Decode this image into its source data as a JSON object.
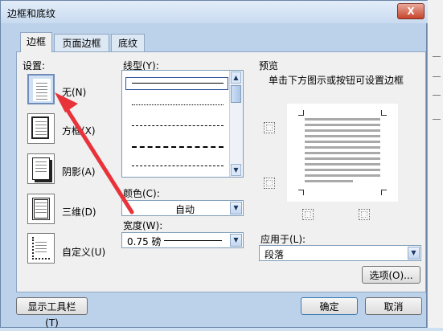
{
  "window": {
    "title": "边框和底纹",
    "close_glyph": "X"
  },
  "tabs": [
    {
      "label": "边框",
      "active": true
    },
    {
      "label": "页面边框",
      "active": false
    },
    {
      "label": "底纹",
      "active": false
    }
  ],
  "settings": {
    "label": "设置:",
    "options": [
      {
        "label": "无(N)",
        "selected": true
      },
      {
        "label": "方框(X)"
      },
      {
        "label": "阴影(A)"
      },
      {
        "label": "三维(D)"
      },
      {
        "label": "自定义(U)"
      }
    ]
  },
  "line_style": {
    "label": "线型(Y):"
  },
  "color": {
    "label": "颜色(C):",
    "value": "自动"
  },
  "width": {
    "label": "宽度(W):",
    "value": "0.75 磅"
  },
  "preview": {
    "label": "预览",
    "hint": "单击下方图示或按钮可设置边框"
  },
  "apply_to": {
    "label": "应用于(L):",
    "value": "段落"
  },
  "buttons": {
    "options": "选项(O)...",
    "show_toolbar": "显示工具栏(T)",
    "ok": "确定",
    "cancel": "取消"
  },
  "colors": {
    "accent_arrow": "#e8333a",
    "dialog_bg": "#bcd1ea",
    "panel_bg": "#f0f0f0"
  }
}
